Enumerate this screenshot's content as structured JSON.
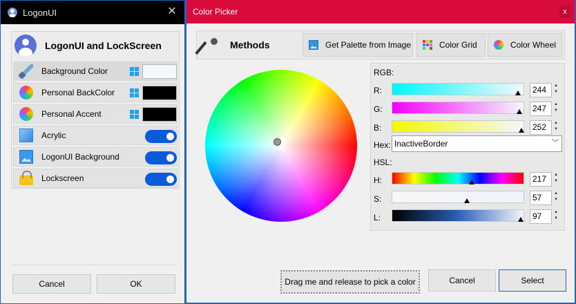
{
  "logon_window": {
    "title": "LogonUI",
    "panel_title": "LogonUI and LockScreen",
    "items": [
      {
        "label": "Background Color",
        "icon": "paintbrush-icon",
        "swatch": "#f4f7fc"
      },
      {
        "label": "Personal BackColor",
        "icon": "color-wheel-icon",
        "swatch": "#000000"
      },
      {
        "label": "Personal Accent",
        "icon": "color-wheel-icon",
        "swatch": "#000000"
      },
      {
        "label": "Acrylic",
        "icon": "acrylic-icon",
        "toggle": "on"
      },
      {
        "label": "LogonUI Background",
        "icon": "image-icon",
        "toggle": "on"
      },
      {
        "label": "Lockscreen",
        "icon": "lock-icon",
        "toggle": "on"
      }
    ],
    "cancel_label": "Cancel",
    "ok_label": "OK"
  },
  "picker_window": {
    "title": "Color Picker",
    "close_label": "x",
    "methods": {
      "title": "Methods",
      "buttons": [
        "Get Palette from Image",
        "Color Grid",
        "Color Wheel"
      ]
    },
    "rgb": {
      "section": "RGB:",
      "r_label": "R:",
      "r": "244",
      "g_label": "G:",
      "g": "247",
      "b_label": "B:",
      "b": "252"
    },
    "hex_label": "Hex:",
    "hex_value": "InactiveBorder",
    "hsl": {
      "section": "HSL:",
      "h_label": "H:",
      "h": "217",
      "s_label": "S:",
      "s": "57",
      "l_label": "L:",
      "l": "97"
    },
    "drag_label": "Drag me and release to pick a color",
    "cancel_label": "Cancel",
    "select_label": "Select"
  },
  "colors": {
    "picker_title_bar": "#d90b3a",
    "window_border": "#1e63c6",
    "toggle_on": "#0a5bd8",
    "selected_color": "#f4f7fc"
  }
}
